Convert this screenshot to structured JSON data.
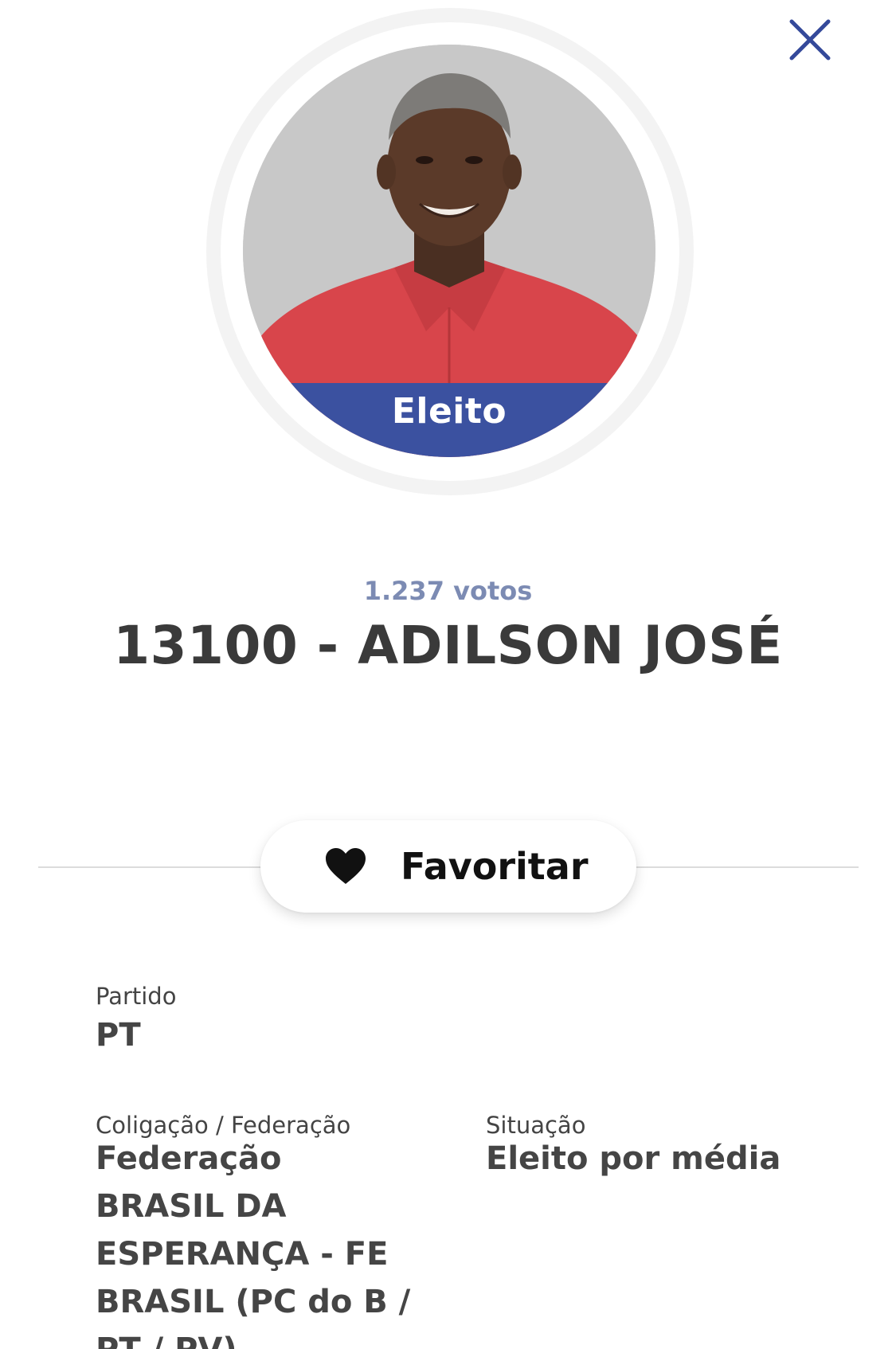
{
  "header": {
    "close_icon": "close-icon",
    "accent_color": "#3b51a0"
  },
  "candidate": {
    "photo_description": "candidate-portrait",
    "status_badge": "Eleito",
    "votes": "1.237 votos",
    "name": "13100 - ADILSON JOSÉ"
  },
  "favorite": {
    "icon": "heart-icon",
    "label": "Favoritar"
  },
  "details": {
    "party": {
      "label": "Partido",
      "value": "PT"
    },
    "coalition": {
      "label": "Coligação / Federação",
      "value": "Federação BRASIL DA ESPERANÇA - FE BRASIL (PC do B / PT / PV)"
    },
    "situation": {
      "label": "Situação",
      "value": "Eleito por média"
    }
  }
}
